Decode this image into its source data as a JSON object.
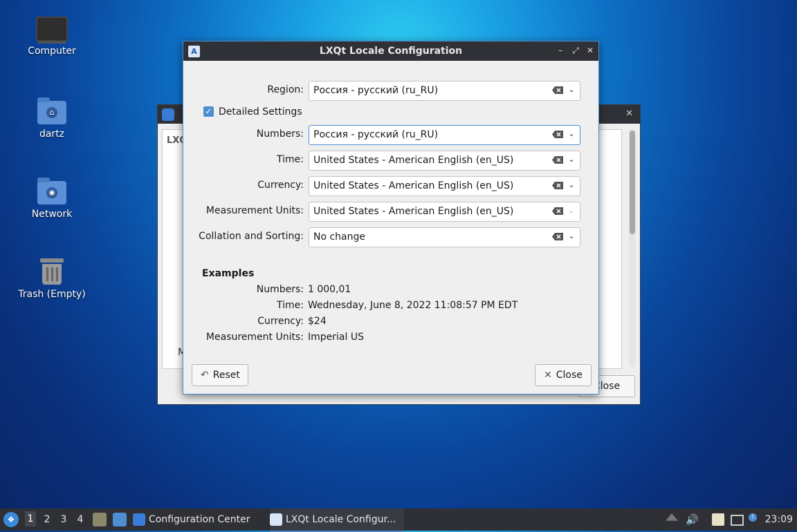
{
  "desktop": {
    "icons": [
      {
        "label": "Computer",
        "icon": "computer-icon"
      },
      {
        "label": "dartz",
        "icon": "home-folder-icon"
      },
      {
        "label": "Network",
        "icon": "network-folder-icon"
      },
      {
        "label": "Trash (Empty)",
        "icon": "trash-icon"
      }
    ]
  },
  "background_window": {
    "partial_text": "LXQ",
    "partial_label": "M",
    "close_label": "Close"
  },
  "dialog": {
    "title": "LXQt Locale Configuration",
    "region": {
      "label": "Region:",
      "value": "Россия - русский (ru_RU)"
    },
    "detailed_settings": {
      "label": "Detailed Settings",
      "checked": true
    },
    "fields": [
      {
        "label": "Numbers:",
        "value": "Россия - русский (ru_RU)"
      },
      {
        "label": "Time:",
        "value": "United States - American English (en_US)"
      },
      {
        "label": "Currency:",
        "value": "United States - American English (en_US)"
      },
      {
        "label": "Measurement Units:",
        "value": "United States - American English (en_US)"
      },
      {
        "label": "Collation and Sorting:",
        "value": "No change"
      }
    ],
    "examples": {
      "heading": "Examples",
      "rows": [
        {
          "label": "Numbers:",
          "value": "1 000,01"
        },
        {
          "label": "Time:",
          "value": "Wednesday, June 8, 2022 11:08:57 PM EDT"
        },
        {
          "label": "Currency:",
          "value": "$24"
        },
        {
          "label": "Measurement Units:",
          "value": "Imperial US"
        }
      ]
    },
    "reset_label": "Reset",
    "close_label": "Close"
  },
  "taskbar": {
    "workspaces": [
      "1",
      "2",
      "3",
      "4"
    ],
    "active_workspace": "1",
    "tasks": [
      {
        "label": "Configuration Center"
      },
      {
        "label": "LXQt Locale Configur..."
      }
    ],
    "clock": "23:09"
  },
  "colors": {
    "accent": "#4d8fd1",
    "titlebar": "#2f3136",
    "taskbar": "#2e3035"
  }
}
